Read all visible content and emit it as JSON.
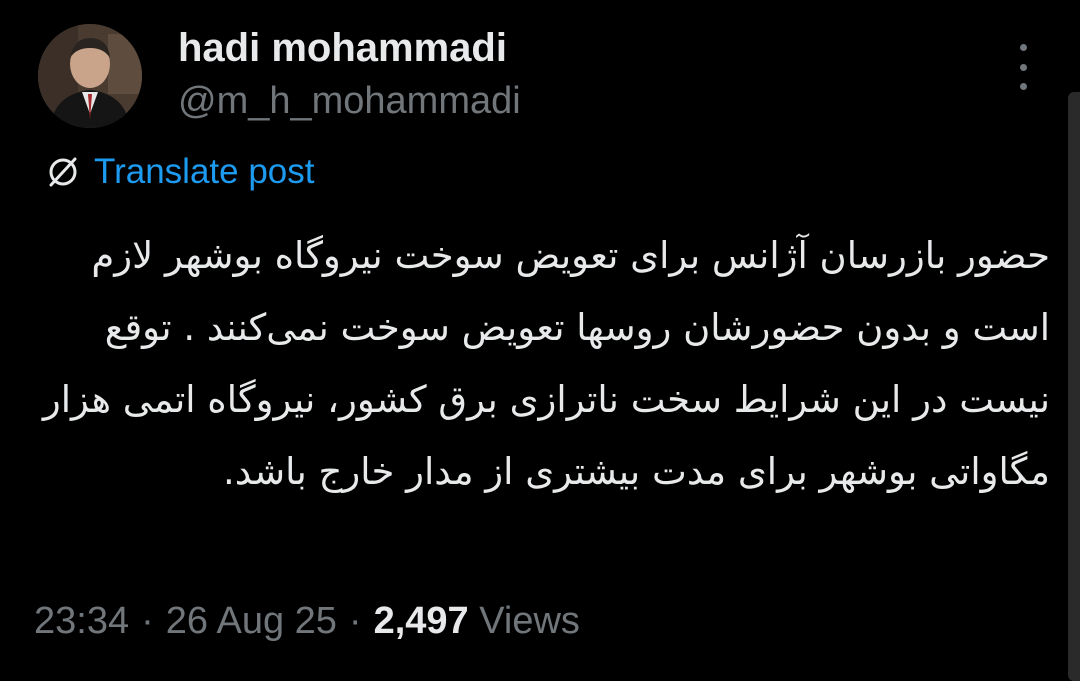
{
  "author": {
    "name": "hadi mohammadi",
    "handle": "@m_h_mohammadi"
  },
  "translate": {
    "label": "Translate post",
    "icon": "globe-slash-icon"
  },
  "post": {
    "text": "حضور بازرسان آژانس برای تعویض سوخت نیروگاه بوشهر لازم است و بدون حضورشان روسها تعویض سوخت نمی‌کنند . توقع نیست در این شرایط سخت ناترازی برق کشور، نیروگاه اتمی هزار مگاواتی بوشهر برای مدت بیشتری از مدار خارج باشد."
  },
  "meta": {
    "time": "23:34",
    "separator": "·",
    "date": "26 Aug 25",
    "views_count": "2,497",
    "views_label": "Views"
  },
  "colors": {
    "background": "#000000",
    "text": "#e7e9ea",
    "secondary": "#71767b",
    "accent": "#1d9bf0"
  }
}
